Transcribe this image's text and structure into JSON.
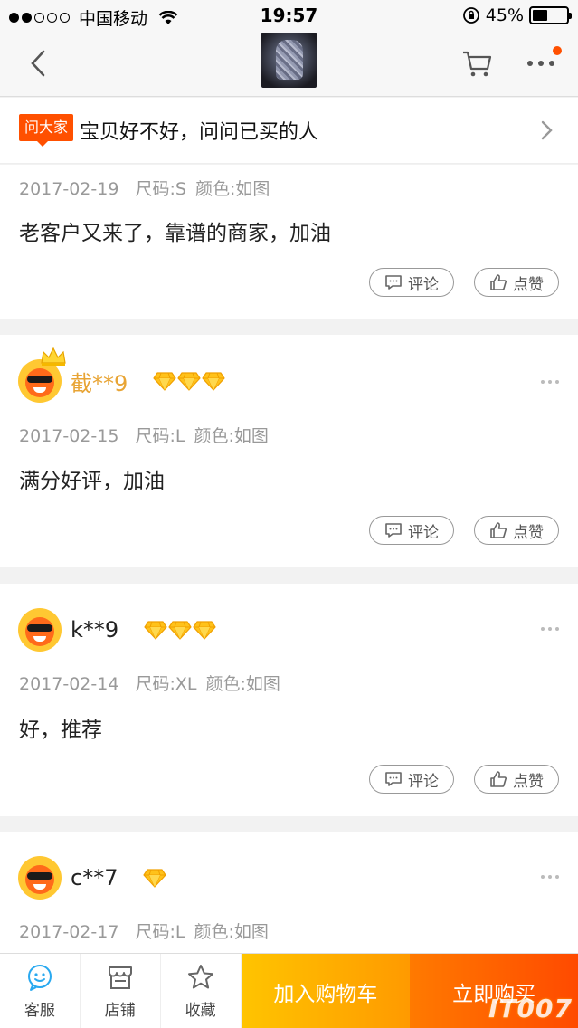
{
  "status_bar": {
    "carrier": "中国移动",
    "time": "19:57",
    "battery": "45%",
    "battery_level": 0.45
  },
  "ask": {
    "badge": "问大家",
    "text": "宝贝好不好，问问已买的人"
  },
  "actions": {
    "comment": "评论",
    "like": "点赞"
  },
  "reviews": [
    {
      "date": "2017-02-19",
      "size": "尺码:S",
      "color": "颜色:如图",
      "content": "老客户又来了，靠谱的商家，加油"
    },
    {
      "username": "截**9",
      "diamonds": 3,
      "date": "2017-02-15",
      "size": "尺码:L",
      "color": "颜色:如图",
      "content": "满分好评，加油"
    },
    {
      "username": "k**9",
      "diamonds": 3,
      "date": "2017-02-14",
      "size": "尺码:XL",
      "color": "颜色:如图",
      "content": "好，推荐"
    },
    {
      "username": "c**7",
      "diamonds": 1,
      "date": "2017-02-17",
      "size": "尺码:L",
      "color": "颜色:如图"
    }
  ],
  "bottom_bar": {
    "service": "客服",
    "shop": "店铺",
    "favorite": "收藏",
    "add_to_cart": "加入购物车",
    "buy_now": "立即购买",
    "watermark": "IT007"
  },
  "colors": {
    "accent": "#ff5000",
    "vip_name": "#e8a434",
    "cart_button": "#ffb000",
    "buy_button": "#ff5a00"
  }
}
